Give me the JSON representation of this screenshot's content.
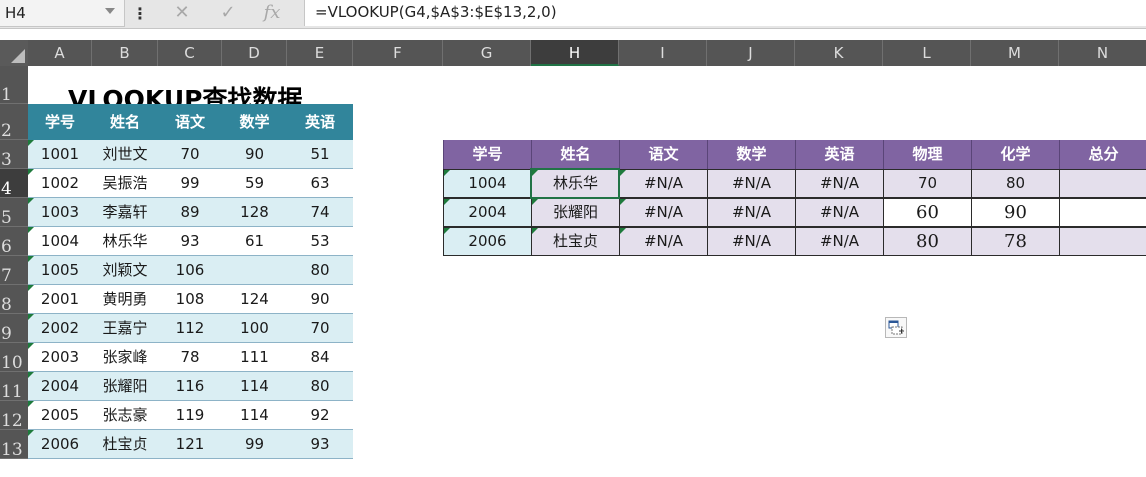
{
  "name_box": "H4",
  "formula": "=VLOOKUP(G4,$A$3:$E$13,2,0)",
  "formula_bar_icons": {
    "more": "vertical-ellipsis-icon",
    "cancel": "close-icon",
    "enter": "check-icon",
    "fx": "fx-icon"
  },
  "icon_glyphs": {
    "more": "⋮",
    "cancel": "✕",
    "enter": "✓",
    "fx": "fx"
  },
  "columns": [
    "A",
    "B",
    "C",
    "D",
    "E",
    "F",
    "G",
    "H",
    "I",
    "J",
    "K",
    "L",
    "M",
    "N"
  ],
  "rows": [
    "1",
    "2",
    "3",
    "4",
    "5",
    "6",
    "7",
    "8",
    "9",
    "10",
    "11",
    "12",
    "13"
  ],
  "selected_cell": {
    "column": "H",
    "row": "4"
  },
  "title": "VLOOKUP查找数据",
  "source_table": {
    "headers": [
      "学号",
      "姓名",
      "语文",
      "数学",
      "英语"
    ],
    "rows": [
      [
        "1001",
        "刘世文",
        "70",
        "90",
        "51"
      ],
      [
        "1002",
        "吴振浩",
        "99",
        "59",
        "63"
      ],
      [
        "1003",
        "李嘉轩",
        "89",
        "128",
        "74"
      ],
      [
        "1004",
        "林乐华",
        "93",
        "61",
        "53"
      ],
      [
        "1005",
        "刘颖文",
        "106",
        "",
        "80"
      ],
      [
        "2001",
        "黄明勇",
        "108",
        "124",
        "90"
      ],
      [
        "2002",
        "王嘉宁",
        "112",
        "100",
        "70"
      ],
      [
        "2003",
        "张家峰",
        "78",
        "111",
        "84"
      ],
      [
        "2004",
        "张耀阳",
        "116",
        "114",
        "80"
      ],
      [
        "2005",
        "张志豪",
        "119",
        "114",
        "92"
      ],
      [
        "2006",
        "杜宝贞",
        "121",
        "99",
        "93"
      ]
    ]
  },
  "lookup_table": {
    "headers": [
      "学号",
      "姓名",
      "语文",
      "数学",
      "英语",
      "物理",
      "化学",
      "总分"
    ],
    "rows": [
      [
        "1004",
        "林乐华",
        "#N/A",
        "#N/A",
        "#N/A",
        "70",
        "80",
        ""
      ],
      [
        "2004",
        "张耀阳",
        "#N/A",
        "#N/A",
        "#N/A",
        "60",
        "90",
        ""
      ],
      [
        "2006",
        "杜宝贞",
        "#N/A",
        "#N/A",
        "#N/A",
        "80",
        "78",
        ""
      ]
    ]
  },
  "colors": {
    "source_header_bg": "#31859b",
    "source_band": "#daeef3",
    "lookup_header_bg": "#8064a2",
    "lookup_band": "#e4dfec",
    "selection": "#217346",
    "error_marker": "#1e7a3c"
  },
  "paste_options_icon": "paste-options-icon"
}
